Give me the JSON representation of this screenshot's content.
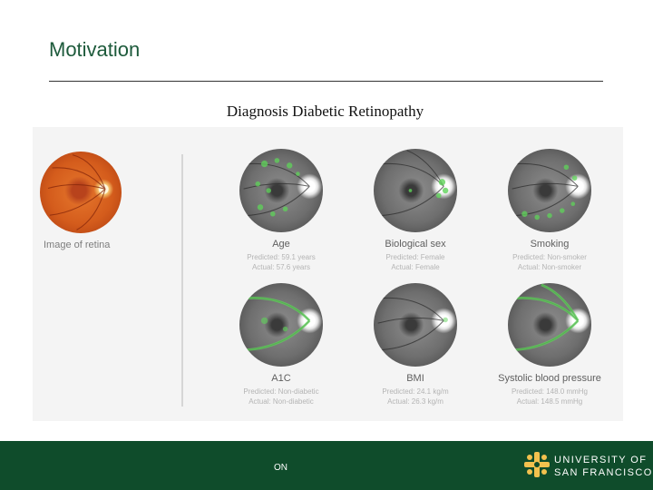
{
  "slide": {
    "title": "Motivation",
    "subtitle": "Diagnosis Diabetic Retinopathy"
  },
  "figure": {
    "input_label": "Image of retina",
    "cells": [
      {
        "title": "Age",
        "predicted": "Predicted: 59.1 years",
        "actual": "Actual: 57.6 years"
      },
      {
        "title": "Biological sex",
        "predicted": "Predicted: Female",
        "actual": "Actual: Female"
      },
      {
        "title": "Smoking",
        "predicted": "Predicted: Non-smoker",
        "actual": "Actual: Non-smoker"
      },
      {
        "title": "A1C",
        "predicted": "Predicted: Non-diabetic",
        "actual": "Actual: Non-diabetic"
      },
      {
        "title": "BMI",
        "predicted": "Predicted: 24.1 kg/m",
        "actual": "Actual: 26.3 kg/m"
      },
      {
        "title": "Systolic blood pressure",
        "predicted": "Predicted: 148.0 mmHg",
        "actual": "Actual: 148.5 mmHg"
      }
    ]
  },
  "footer": {
    "center_text": "ON",
    "logo_line1": "UNIVERSITY OF",
    "logo_line2": "SAN FRANCISCO"
  },
  "colors": {
    "title_green": "#1d5a3b",
    "footer_green": "#0f4c2b",
    "logo_gold": "#f2c14e",
    "heatmap_green": "#5fd45a"
  }
}
